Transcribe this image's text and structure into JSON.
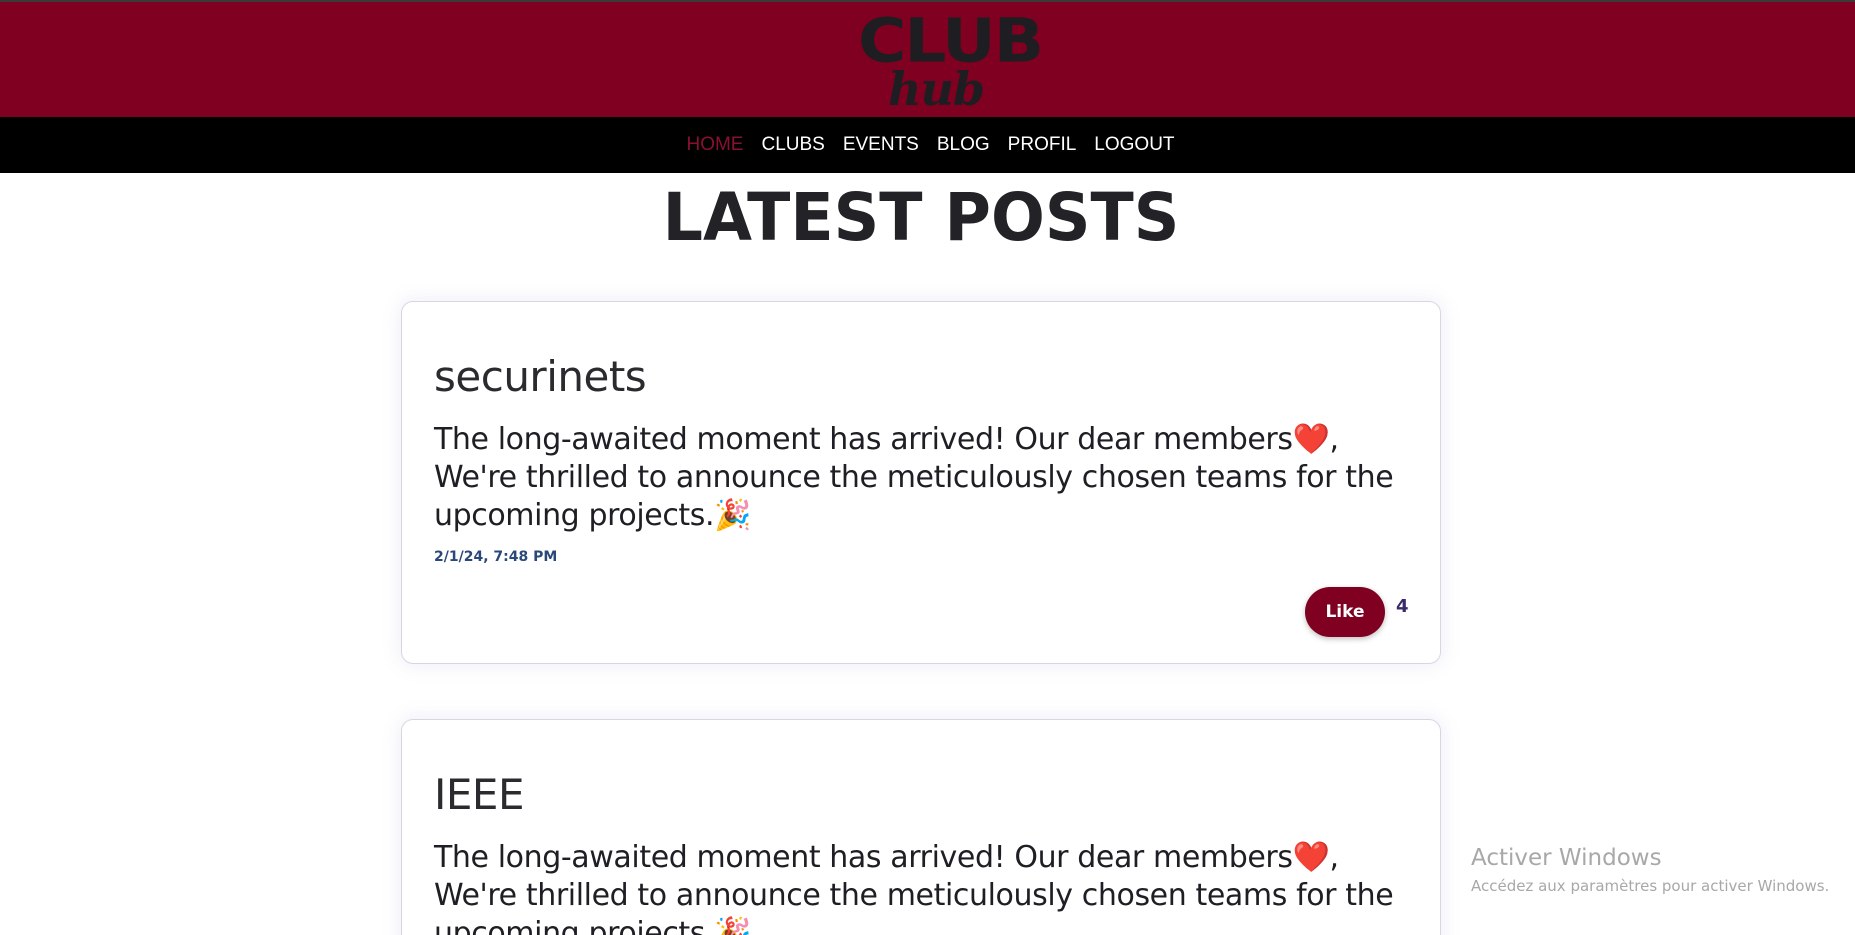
{
  "logo": {
    "line1": "CLUB",
    "line2": "hub"
  },
  "nav": {
    "items": [
      {
        "label": "HOME",
        "active": true
      },
      {
        "label": "CLUBS",
        "active": false
      },
      {
        "label": "EVENTS",
        "active": false
      },
      {
        "label": "BLOG",
        "active": false
      },
      {
        "label": "PROFIL",
        "active": false
      },
      {
        "label": "LOGOUT",
        "active": false
      }
    ]
  },
  "page_title": "LATEST POSTS",
  "posts": [
    {
      "club": "securinets",
      "text": "The long-awaited moment has arrived! Our dear members❤️, We're thrilled to announce the meticulously chosen teams for the upcoming projects.🎉",
      "date": "2/1/24, 7:48 PM",
      "like_label": "Like",
      "likes": "4"
    },
    {
      "club": "IEEE",
      "text": "The long-awaited moment has arrived! Our dear members❤️, We're thrilled to announce the meticulously chosen teams for the upcoming projects.🎉"
    }
  ],
  "watermark": {
    "title": "Activer Windows",
    "subtitle": "Accédez aux paramètres pour activer Windows."
  },
  "colors": {
    "brand": "#7f0020",
    "nav_bg": "#000000",
    "active_nav": "#8a1030",
    "date": "#2a4878",
    "like_count": "#3a2a6a"
  }
}
